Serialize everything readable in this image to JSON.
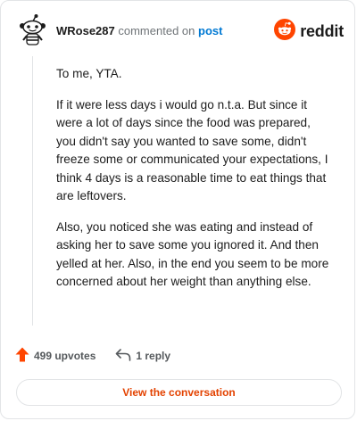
{
  "header": {
    "username": "WRose287",
    "verb": "commented on",
    "target": "post",
    "brand": "reddit"
  },
  "comment": {
    "paragraphs": [
      "To me, YTA.",
      "If it were less days i would go n.t.a. But since it were a lot of days since the food was prepared, you didn't say you wanted to save some, didn't freeze some or communicated your expectations, I think 4 days is a reasonable time to eat things that are leftovers.",
      "Also, you noticed she was eating and instead of asking her to save some you ignored it. And then yelled at her. Also, in the end you seem to be more concerned about her weight than anything else."
    ]
  },
  "actions": {
    "upvotes": "499 upvotes",
    "replies": "1 reply"
  },
  "cta": {
    "label": "View the conversation"
  },
  "icons": {
    "avatar": "snoo-avatar-icon",
    "brand": "reddit-logo-icon",
    "upvote": "upvote-arrow-icon",
    "reply": "reply-arrow-icon"
  },
  "colors": {
    "brand_orange": "#ff4500",
    "link_blue": "#0079d3",
    "cta_text": "#e34200",
    "text": "#1c1c1c",
    "muted": "#6f7478"
  }
}
